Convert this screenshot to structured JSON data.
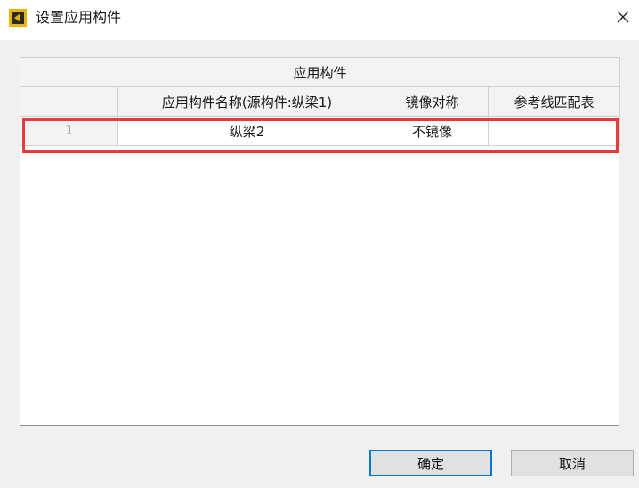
{
  "window": {
    "title": "设置应用构件"
  },
  "grid": {
    "group_header": "应用构件",
    "columns": [
      "",
      "应用构件名称(源构件:纵梁1)",
      "镜像对称",
      "参考线匹配表"
    ],
    "rows": [
      {
        "index": "1",
        "name": "纵梁2",
        "mirror": "不镜像",
        "ref_match": ""
      }
    ]
  },
  "buttons": {
    "ok": "确定",
    "cancel": "取消"
  },
  "colors": {
    "highlight": "#e8393c",
    "ok_border": "#0078d7",
    "icon_bg": "#e8b500"
  }
}
